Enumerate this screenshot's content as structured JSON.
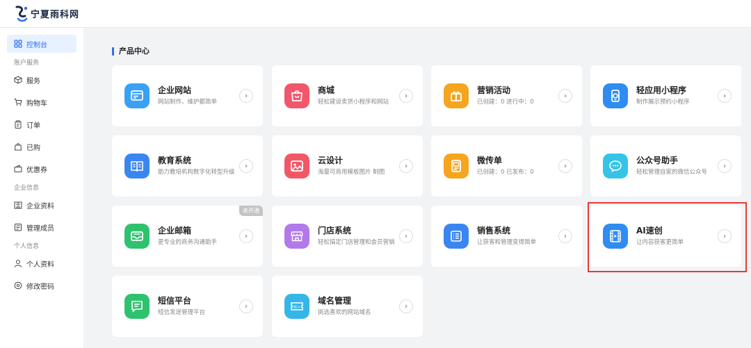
{
  "header": {
    "logo_text": "宁夏雨科网"
  },
  "sidebar": {
    "items": [
      {
        "label": "控制台",
        "icon": "grid-icon",
        "active": true
      },
      {
        "group": "账户服务"
      },
      {
        "label": "服务",
        "icon": "box-icon"
      },
      {
        "label": "购物车",
        "icon": "cart-icon"
      },
      {
        "label": "订单",
        "icon": "clipboard-icon"
      },
      {
        "label": "已购",
        "icon": "bag-icon"
      },
      {
        "label": "优惠券",
        "icon": "coupon-icon"
      },
      {
        "group": "企业信息"
      },
      {
        "label": "企业资料",
        "icon": "building-icon"
      },
      {
        "label": "管理成员",
        "icon": "members-icon"
      },
      {
        "group": "个人信息"
      },
      {
        "label": "个人资料",
        "icon": "user-icon"
      },
      {
        "label": "修改密码",
        "icon": "lock-icon"
      }
    ]
  },
  "main": {
    "section_title": "产品中心",
    "cards": [
      {
        "title": "企业网站",
        "desc": "网站制作、维护都简单",
        "color": "#3aa0f5",
        "icon": "website-icon"
      },
      {
        "title": "商城",
        "desc": "轻松建设卖货小程序和网站",
        "color": "#f2566b",
        "icon": "shop-bag-icon"
      },
      {
        "title": "营销活动",
        "desc": "已创建：0   进行中：0",
        "color": "#f5a51e",
        "icon": "gift-icon"
      },
      {
        "title": "轻应用小程序",
        "desc": "制作展示预约小程序",
        "color": "#2f8cf0",
        "icon": "miniapp-icon"
      },
      {
        "title": "教育系统",
        "desc": "助力教培机构数字化转型升级",
        "color": "#3a86f0",
        "icon": "book-icon"
      },
      {
        "title": "云设计",
        "desc": "海量可商用模板图片 制图",
        "color": "#f25767",
        "icon": "image-icon"
      },
      {
        "title": "微传单",
        "desc": "已创建：0   已发布：0",
        "color": "#f5a51e",
        "icon": "flyer-icon"
      },
      {
        "title": "公众号助手",
        "desc": "轻松管理自家的微信公众号",
        "color": "#35c3e8",
        "icon": "wechat-icon"
      },
      {
        "title": "企业邮箱",
        "desc": "更专业的商务沟通助手",
        "color": "#2fc26e",
        "icon": "mail-icon",
        "badge": "未开通"
      },
      {
        "title": "门店系统",
        "desc": "轻松搞定门店管理和会员营销",
        "color": "#b179ea",
        "icon": "store-icon"
      },
      {
        "title": "销售系统",
        "desc": "让获客和管理变得简单",
        "color": "#3a86f0",
        "icon": "list-icon"
      },
      {
        "title": "AI速创",
        "desc": "让内容获客更简单",
        "color": "#2f8cf0",
        "icon": "video-icon"
      },
      {
        "title": "短信平台",
        "desc": "短信发送管理平台",
        "color": "#2fc26e",
        "icon": "sms-icon"
      },
      {
        "title": "域名管理",
        "desc": "挑选喜欢的网站域名",
        "color": "#35b6e8",
        "icon": "domain-icon"
      }
    ]
  }
}
